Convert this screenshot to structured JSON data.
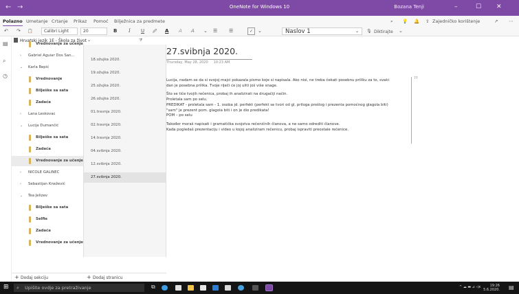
{
  "app": {
    "title": "OneNote for Windows 10",
    "user": "Bozana Tenji",
    "nav_back": "←",
    "nav_forward": "→",
    "win_min": "–",
    "win_max": "☐",
    "win_close": "✕"
  },
  "menu": {
    "items": [
      "Polazno",
      "Umetanje",
      "Crtanje",
      "Prikaz",
      "Pomoć",
      "Bilježnica za predmete"
    ],
    "active": "Polazno",
    "share_label": "Zajedničko korištenje",
    "more": "⋯"
  },
  "toolbar": {
    "font_name": "Calibri Light",
    "font_size": "20",
    "bold": "B",
    "italic": "I",
    "underline": "U",
    "style": "Naslov 1",
    "dictate_label": "Diktirajte",
    "bullets": "☰",
    "numbering": "☰",
    "checkbox": "✓",
    "undo": "↶",
    "redo": "↷",
    "clipboard": "📋",
    "highlight": "🖉",
    "font_color": "A",
    "clear_formatting": "A",
    "more_formatting": "⌄",
    "dictate_icon": "🎙",
    "search": "⌕",
    "lightbulb": "💡",
    "bell": "🔔",
    "share_icon": "⇪",
    "expand": "↗"
  },
  "left_rail": {
    "notebooks": "▤",
    "search": "⌕",
    "recent": "◷"
  },
  "notebook": {
    "name": "Hrvatski jezik 1E - Škola za život",
    "dropdown": "⌄",
    "filter": "⧩"
  },
  "sections": [
    {
      "label": "Vrednovanje za učenje",
      "type": "section",
      "color": "#d7b45a",
      "indent": true
    },
    {
      "label": "Gabriel Aguiar Dos San...",
      "type": "group",
      "expanded": false
    },
    {
      "label": "Karla Repić",
      "type": "group",
      "expanded": true
    },
    {
      "label": "Vrednovanje",
      "type": "section",
      "color": "#d7b45a",
      "indent": true
    },
    {
      "label": "Bilješke sa sata",
      "type": "section",
      "color": "#d7b45a",
      "indent": true
    },
    {
      "label": "Zadaća",
      "type": "section",
      "color": "#d7b45a",
      "indent": true
    },
    {
      "label": "Lana Leskovac",
      "type": "group",
      "expanded": false
    },
    {
      "label": "Lucija Dumančić",
      "type": "group",
      "expanded": true
    },
    {
      "label": "Bilješke sa sata",
      "type": "section",
      "color": "#d7b45a",
      "indent": true
    },
    {
      "label": "Zadaća",
      "type": "section",
      "color": "#d7b45a",
      "indent": true
    },
    {
      "label": "Vrednovanje za učenje",
      "type": "section",
      "color": "#d7b45a",
      "indent": true,
      "selected": true
    },
    {
      "label": "NICOLE GALINEC",
      "type": "group",
      "expanded": false
    },
    {
      "label": "Sebastijan Knežević",
      "type": "group",
      "expanded": false
    },
    {
      "label": "Tea Jelizev",
      "type": "group",
      "expanded": true
    },
    {
      "label": "Bilješke sa sata",
      "type": "section",
      "color": "#d7b45a",
      "indent": true
    },
    {
      "label": "Selfie",
      "type": "section",
      "color": "#d7b45a",
      "indent": true
    },
    {
      "label": "Zadaća",
      "type": "section",
      "color": "#d7b45a",
      "indent": true
    },
    {
      "label": "Vrednovanje za učenje",
      "type": "section",
      "color": "#d7b45a",
      "indent": true
    }
  ],
  "chevron_right": "›",
  "chevron_down": "⌄",
  "pages": [
    {
      "label": "18.ožujka 2020."
    },
    {
      "label": "19.ožujka 2020."
    },
    {
      "label": "25.ožujka 2020."
    },
    {
      "label": "26.ožujka 2020."
    },
    {
      "label": "01.travnja 2020."
    },
    {
      "label": "02.travnja 2020."
    },
    {
      "label": "14.travnja 2020."
    },
    {
      "label": "04.svibnja 2020."
    },
    {
      "label": "12.svibnja 2020."
    },
    {
      "label": "27.svibnja 2020.",
      "selected": true
    }
  ],
  "bottom": {
    "add_section": "Dodaj sekciju",
    "add_page": "Dodaj stranicu",
    "plus": "+"
  },
  "page": {
    "title": "27.svibnja 2020.",
    "date": "Thursday, May 28, 2020",
    "time": "10:23 AM",
    "margin_note": "77",
    "lines": [
      "Lucija, nadam se da si svojoj majci pokazala pismo koje si napisala. Ako nisi, ne treba čekati posebnu priliku za to, svaki",
      "dan je posebna prilika. Tvoje riječi će joj uliti još više snage.",
      "",
      "Što se tiče tvojih rečenica, probaj ih analizirati na drugačiji način.",
      "Proletala sam po selu.",
      "PREDIKAT - proletala sam - 1. osoba jd. perfekt (perfekt se tvori od gl. priloga prošlog i prezenta pomoćnog glagola biti)",
      "\"sam\" je prezent pom. glagola biti i on je dio predikata!",
      "POM – po selu",
      "",
      "Također moraš napisati i gramatička svojstva rečeničnih članova, a ne samo odrediti članove.",
      "Kada pogledaš prezentaciju i video u kojoj analiziram rečenicu, probaj ispraviti preostale rečenice."
    ]
  },
  "taskbar": {
    "start": "⊞",
    "search_placeholder": "Upišite ovdje za pretraživanje",
    "search_icon": "⌕",
    "task_view": "⧉",
    "time": "19:26",
    "date": "5.6.2020.",
    "tray_icons": "^ ☁ ▬ ⊿ ◁x",
    "notifications": "▤"
  },
  "colors": {
    "accent": "#7f49a6",
    "section": "#d7b45a",
    "taskbar": "#141414"
  }
}
